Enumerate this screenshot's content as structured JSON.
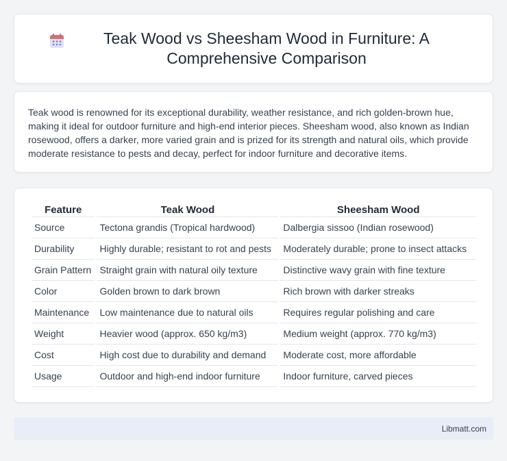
{
  "header": {
    "icon": "calendar-icon",
    "title": "Teak Wood vs Sheesham Wood in Furniture: A Comprehensive Comparison"
  },
  "intro": {
    "text": "Teak wood is renowned for its exceptional durability, weather resistance, and rich golden-brown hue, making it ideal for outdoor furniture and high-end interior pieces. Sheesham wood, also known as Indian rosewood, offers a darker, more varied grain and is prized for its strength and natural oils, which provide moderate resistance to pests and decay, perfect for indoor furniture and decorative items."
  },
  "table": {
    "headers": [
      "Feature",
      "Teak Wood",
      "Sheesham Wood"
    ],
    "rows": [
      [
        "Source",
        "Tectona grandis (Tropical hardwood)",
        "Dalbergia sissoo (Indian rosewood)"
      ],
      [
        "Durability",
        "Highly durable; resistant to rot and pests",
        "Moderately durable; prone to insect attacks"
      ],
      [
        "Grain Pattern",
        "Straight grain with natural oily texture",
        "Distinctive wavy grain with fine texture"
      ],
      [
        "Color",
        "Golden brown to dark brown",
        "Rich brown with darker streaks"
      ],
      [
        "Maintenance",
        "Low maintenance due to natural oils",
        "Requires regular polishing and care"
      ],
      [
        "Weight",
        "Heavier wood (approx. 650 kg/m3)",
        "Medium weight (approx. 770 kg/m3)"
      ],
      [
        "Cost",
        "High cost due to durability and demand",
        "Moderate cost, more affordable"
      ],
      [
        "Usage",
        "Outdoor and high-end indoor furniture",
        "Indoor furniture, carved pieces"
      ]
    ]
  },
  "footer": {
    "brand": "Libmatt.com"
  }
}
